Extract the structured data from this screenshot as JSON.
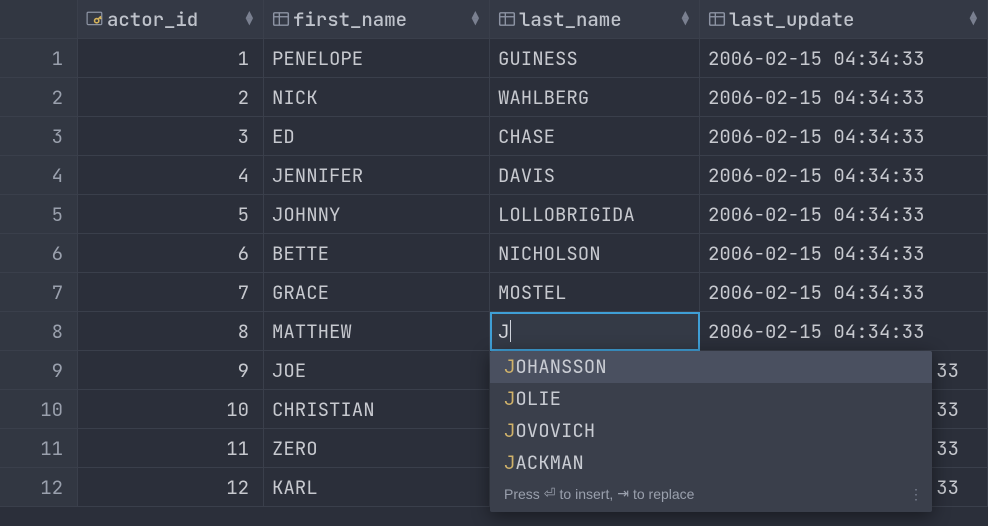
{
  "columns": [
    {
      "name": "actor_id",
      "is_key": true,
      "align": "right"
    },
    {
      "name": "first_name",
      "is_key": false,
      "align": "left"
    },
    {
      "name": "last_name",
      "is_key": false,
      "align": "left"
    },
    {
      "name": "last_update",
      "is_key": false,
      "align": "left"
    }
  ],
  "rows": [
    {
      "n": 1,
      "actor_id": 1,
      "first_name": "PENELOPE",
      "last_name": "GUINESS",
      "last_update": "2006-02-15 04:34:33"
    },
    {
      "n": 2,
      "actor_id": 2,
      "first_name": "NICK",
      "last_name": "WAHLBERG",
      "last_update": "2006-02-15 04:34:33"
    },
    {
      "n": 3,
      "actor_id": 3,
      "first_name": "ED",
      "last_name": "CHASE",
      "last_update": "2006-02-15 04:34:33"
    },
    {
      "n": 4,
      "actor_id": 4,
      "first_name": "JENNIFER",
      "last_name": "DAVIS",
      "last_update": "2006-02-15 04:34:33"
    },
    {
      "n": 5,
      "actor_id": 5,
      "first_name": "JOHNNY",
      "last_name": "LOLLOBRIGIDA",
      "last_update": "2006-02-15 04:34:33"
    },
    {
      "n": 6,
      "actor_id": 6,
      "first_name": "BETTE",
      "last_name": "NICHOLSON",
      "last_update": "2006-02-15 04:34:33"
    },
    {
      "n": 7,
      "actor_id": 7,
      "first_name": "GRACE",
      "last_name": "MOSTEL",
      "last_update": "2006-02-15 04:34:33"
    },
    {
      "n": 8,
      "actor_id": 8,
      "first_name": "MATTHEW",
      "last_name": "J",
      "last_update": "2006-02-15 04:34:33"
    },
    {
      "n": 9,
      "actor_id": 9,
      "first_name": "JOE",
      "last_name": "",
      "last_update": "33"
    },
    {
      "n": 10,
      "actor_id": 10,
      "first_name": "CHRISTIAN",
      "last_name": "",
      "last_update": "33"
    },
    {
      "n": 11,
      "actor_id": 11,
      "first_name": "ZERO",
      "last_name": "",
      "last_update": "33"
    },
    {
      "n": 12,
      "actor_id": 12,
      "first_name": "KARL",
      "last_name": "",
      "last_update": "33"
    }
  ],
  "editing": {
    "row_index": 7,
    "column": "last_name",
    "value": "J"
  },
  "autocomplete": {
    "prefix": "J",
    "items": [
      {
        "text": "JOHANSSON",
        "selected": true
      },
      {
        "text": "JOLIE",
        "selected": false
      },
      {
        "text": "JOVOVICH",
        "selected": false
      },
      {
        "text": "JACKMAN",
        "selected": false
      }
    ],
    "hint_prefix": "Press ",
    "hint_insert": " to insert, ",
    "hint_replace": " to replace"
  }
}
